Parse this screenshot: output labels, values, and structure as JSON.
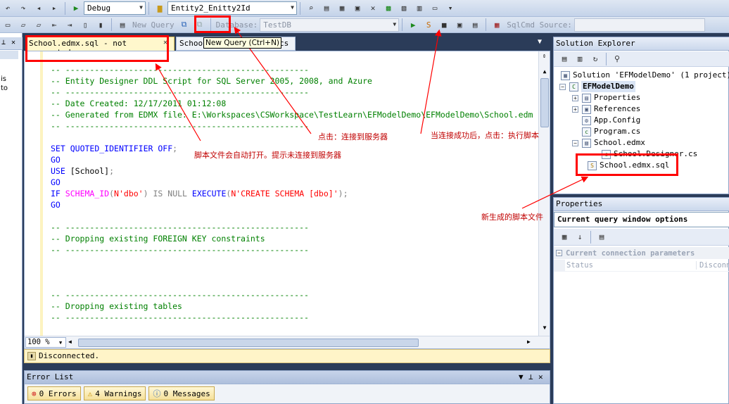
{
  "toolbar1": {
    "config_value": "Debug",
    "project_value": "Entity2_Enitty2Id"
  },
  "toolbar2": {
    "new_query_label": "New Query",
    "database_label": "Database:",
    "database_value": "TestDB",
    "sqlcmd_label": "SqlCmd Source:"
  },
  "tabs": [
    {
      "label": "School.edmx.sql - not connected"
    },
    {
      "label": "School"
    },
    {
      "label": "cs"
    }
  ],
  "tooltip": "New Query (Ctrl+N)",
  "editor": {
    "lines": [
      "-- --------------------------------------------------",
      "-- Entity Designer DDL Script for SQL Server 2005, 2008, and Azure",
      "-- --------------------------------------------------",
      "-- Date Created: 12/17/2011 01:12:08",
      "-- Generated from EDMX file: E:\\Workspaces\\CSWorkspace\\TestLearn\\EFModelDemo\\EFModelDemo\\School.edm",
      "-- --------------------------------------------------",
      "",
      "SET QUOTED_IDENTIFIER OFF;",
      "GO",
      "USE [School];",
      "GO",
      "IF SCHEMA_ID(N'dbo') IS NULL EXECUTE(N'CREATE SCHEMA [dbo]');",
      "GO",
      "",
      "-- --------------------------------------------------",
      "-- Dropping existing FOREIGN KEY constraints",
      "-- --------------------------------------------------",
      "",
      "",
      "",
      "-- --------------------------------------------------",
      "-- Dropping existing tables",
      "-- --------------------------------------------------"
    ],
    "zoom": "100 %",
    "status": "Disconnected."
  },
  "left_strip": [
    "is",
    "to"
  ],
  "error_list": {
    "title": "Error List",
    "errors": "0 Errors",
    "warnings": "4 Warnings",
    "messages": "0 Messages"
  },
  "solution_explorer": {
    "title": "Solution Explorer",
    "solution": "Solution 'EFModelDemo' (1 project)",
    "project": "EFModelDemo",
    "items": [
      "Properties",
      "References",
      "App.Config",
      "Program.cs",
      "School.edmx",
      "School.Designer.cs",
      "School.edmx.sql"
    ]
  },
  "properties": {
    "title": "Properties",
    "object": "Current query window options",
    "category": "Current connection parameters",
    "prop_name": "Status",
    "prop_value": "Disconne"
  },
  "annotations": {
    "connect": "点击：连接到服务器",
    "execute": "当连接成功后，点击：执行脚本",
    "autoopen": "脚本文件会自动打开。提示未连接到服务器",
    "newfile": "新生成的脚本文件"
  },
  "colors": {
    "annotation_red": "#ff0000",
    "ide_background": "#2b3c59",
    "status_bar": "#fff4c8"
  }
}
